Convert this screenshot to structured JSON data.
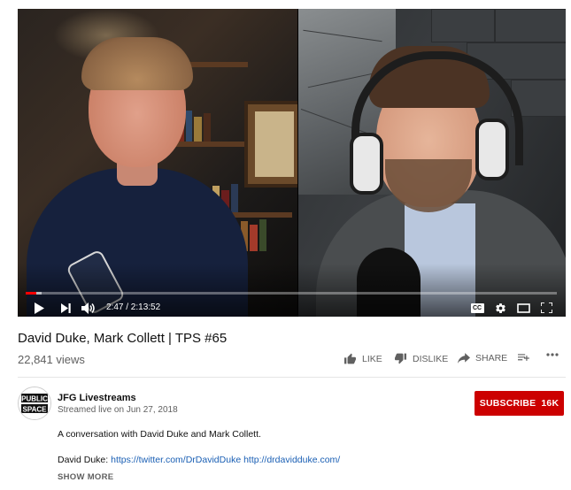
{
  "player": {
    "time_display": "2:47 / 2:13:52",
    "progress_fraction": 0.0208,
    "loaded_fraction": 0.03,
    "cc_label": "CC"
  },
  "video": {
    "title": "David Duke, Mark Collett | TPS #65",
    "views": "22,841 views"
  },
  "actions": {
    "like": "LIKE",
    "dislike": "DISLIKE",
    "share": "SHARE"
  },
  "channel": {
    "name": "JFG Livestreams",
    "streamed": "Streamed live on Jun 27, 2018",
    "avatar_text": "PUBLIC SPACE"
  },
  "subscribe": {
    "label": "SUBSCRIBE",
    "count": "16K"
  },
  "description": {
    "line1": "A conversation with David Duke and Mark Collett.",
    "line2_prefix": "David Duke: ",
    "link1": "https://twitter.com/DrDavidDuke",
    "link2": "http://drdavidduke.com/"
  },
  "show_more": "SHOW MORE",
  "colors": {
    "accent_red": "#cc0000",
    "progress_red": "#ff0000",
    "link_blue": "#1a5fb4"
  }
}
